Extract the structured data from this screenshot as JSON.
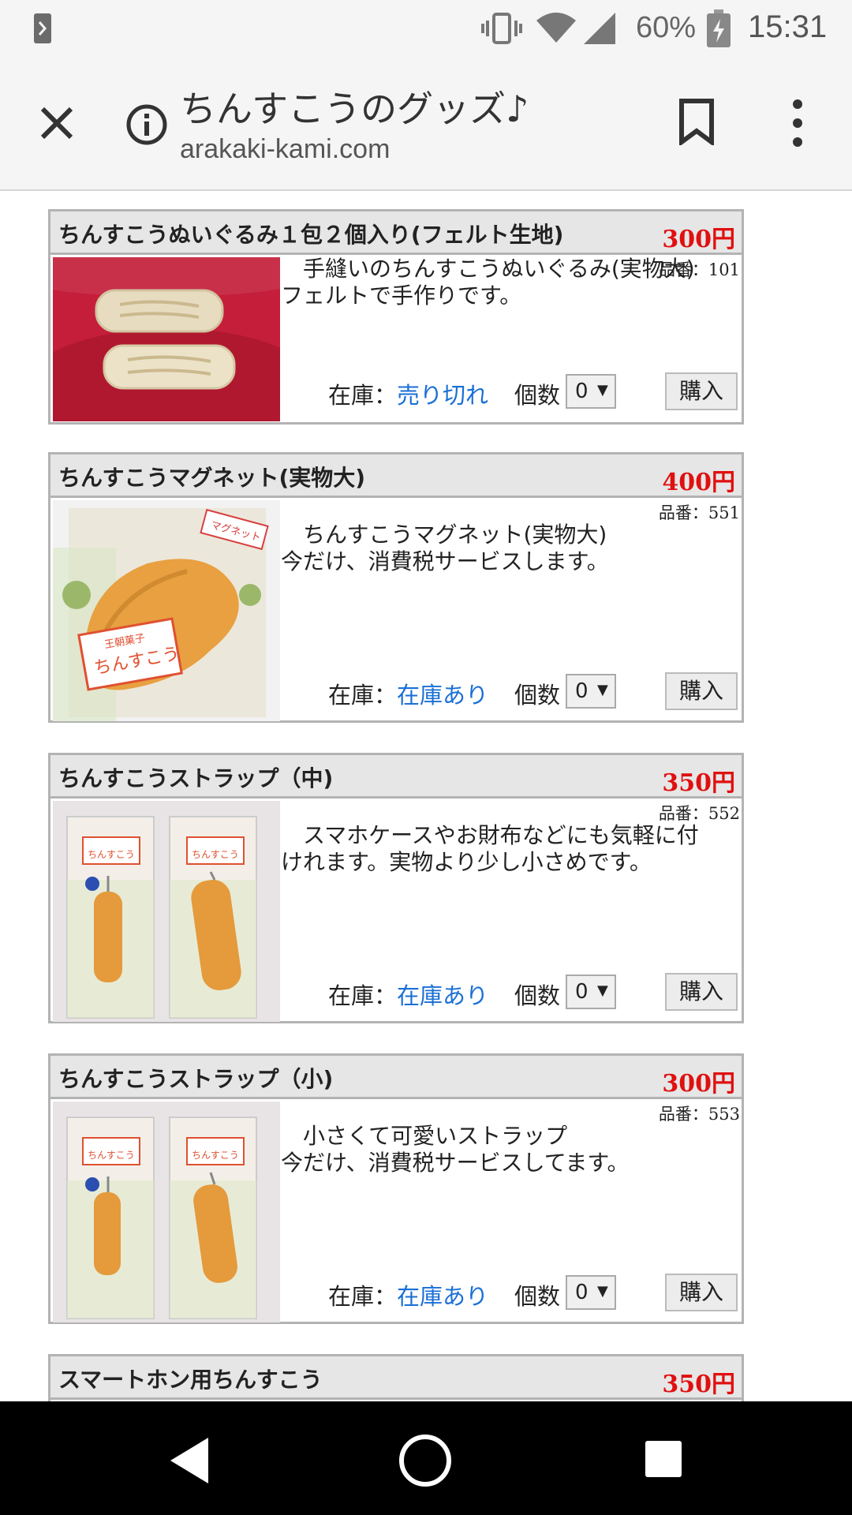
{
  "status_bar": {
    "battery_percent": "60%",
    "time": "15:31",
    "icons": [
      "notification-icon",
      "vibrate-icon",
      "wifi-icon",
      "signal-icon",
      "battery-charging-icon"
    ]
  },
  "browser": {
    "title": "ちんすこうのグッズ♪",
    "url": "arakaki-kami.com",
    "icons": [
      "close-icon",
      "info-icon",
      "bookmark-icon",
      "more-vert-icon"
    ]
  },
  "products": [
    {
      "name": "ちんすこうぬいぐるみ１包２個入り(フェルト生地)",
      "price": "300円",
      "code": "品番：101",
      "desc_line1": "手縫いのちんすこうぬいぐるみ(実物大)",
      "desc_line2": "フェルトで手作りです。",
      "stock_label": "在庫：",
      "stock_value": "売り切れ",
      "qty_label": "個数",
      "qty_value": "0",
      "buy_label": "購入"
    },
    {
      "name": "ちんすこうマグネット(実物大)",
      "price": "400円",
      "code": "品番：551",
      "desc_line1": "ちんすこうマグネット(実物大)",
      "desc_line2": "今だけ、消費税サービスします。",
      "stock_label": "在庫：",
      "stock_value": "在庫あり",
      "qty_label": "個数",
      "qty_value": "0",
      "buy_label": "購入"
    },
    {
      "name": "ちんすこうストラップ（中)",
      "price": "350円",
      "code": "品番：552",
      "desc_line1": "スマホケースやお財布などにも気軽に付",
      "desc_line2": "けれます。実物より少し小さめです。",
      "stock_label": "在庫：",
      "stock_value": "在庫あり",
      "qty_label": "個数",
      "qty_value": "0",
      "buy_label": "購入"
    },
    {
      "name": "ちんすこうストラップ（小)",
      "price": "300円",
      "code": "品番：553",
      "desc_line1": "小さくて可愛いストラップ",
      "desc_line2": "今だけ、消費税サービスしてます。",
      "stock_label": "在庫：",
      "stock_value": "在庫あり",
      "qty_label": "個数",
      "qty_value": "0",
      "buy_label": "購入"
    },
    {
      "name": "スマートホン用ちんすこう",
      "price": "350円"
    }
  ],
  "package_labels": {
    "brand": "王朝菓子",
    "product": "ちんすこう",
    "magnet_tag": "マグネット"
  },
  "nav_bar": {
    "icons": [
      "back-icon",
      "home-icon",
      "recent-apps-icon"
    ]
  },
  "colors": {
    "price": "#e01010",
    "stock_link": "#1a6fd6",
    "header_bg": "#e6e6e6",
    "border": "#b3b3b3"
  }
}
